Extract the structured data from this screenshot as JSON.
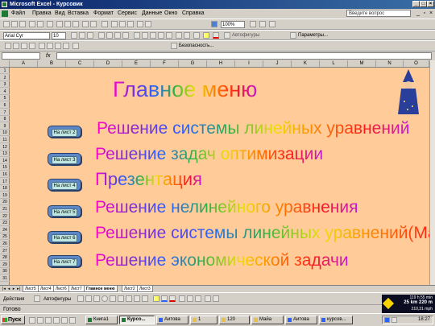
{
  "window": {
    "title": "Microsoft Excel - Курсовик"
  },
  "menu": {
    "items": [
      "Файл",
      "Правка",
      "Вид",
      "Вставка",
      "Формат",
      "Сервис",
      "Данные",
      "Окно",
      "Справка"
    ],
    "ask_placeholder": "Введите вопрос"
  },
  "toolbar": {
    "zoom": "100%",
    "font_name": "Arial Cyr",
    "font_size": "10",
    "drawing_label": "Автофигуры",
    "params_label": "Параметры...",
    "security_label": "Безопасность..."
  },
  "columns": [
    "A",
    "B",
    "C",
    "D",
    "E",
    "F",
    "G",
    "H",
    "I",
    "J",
    "K",
    "L",
    "M",
    "N",
    "O"
  ],
  "rows": [
    "1",
    "2",
    "3",
    "4",
    "5",
    "6",
    "7",
    "8",
    "9",
    "10",
    "11",
    "12",
    "13",
    "14",
    "15",
    "16",
    "17",
    "18",
    "19",
    "20",
    "21",
    "22",
    "23",
    "24",
    "25",
    "26",
    "27",
    "28",
    "29",
    "30",
    "31"
  ],
  "sheet": {
    "background": "#ffcc99",
    "heading": "Главное меню",
    "menu": [
      {
        "button": "На лист 2",
        "label": "Решение системы линейных уравнений"
      },
      {
        "button": "На лист 3",
        "label": "Решение задач оптимизации"
      },
      {
        "button": "На лист 4",
        "label": "Презентация"
      },
      {
        "button": "На лист 5",
        "label": "Решение нелинейного уравнения"
      },
      {
        "button": "На лист 6",
        "label": "Решение системы линейных уравнений(MathCAD)"
      },
      {
        "button": "На лист 7",
        "label": "Решение экономической задачи"
      }
    ]
  },
  "tabs": {
    "items": [
      "Лист5",
      "Лист4",
      "Лист6",
      "Лист7",
      "Главное меню",
      "Лист2",
      "Лист3"
    ],
    "active": "Главное меню"
  },
  "drawbar": {
    "actions_label": "Действия",
    "autoshapes_label": "Автофигуры"
  },
  "status": {
    "text": "Готово"
  },
  "gps": {
    "top": "119 h 55 min",
    "main": "25 km 220 m",
    "bottom": "210,31 mph"
  },
  "taskbar": {
    "start_label": "Пуск",
    "tasks": [
      "Книга1",
      "Курсо...",
      "Аитова",
      "1",
      "120",
      "Майа",
      "Аитова",
      "курсов..."
    ],
    "active_task": "Курсо...",
    "clock": "18:27"
  },
  "colors": {
    "title_bar": "#0a246a",
    "button_fill": "#5d88c7",
    "button_inner": "#bfe7e1"
  }
}
